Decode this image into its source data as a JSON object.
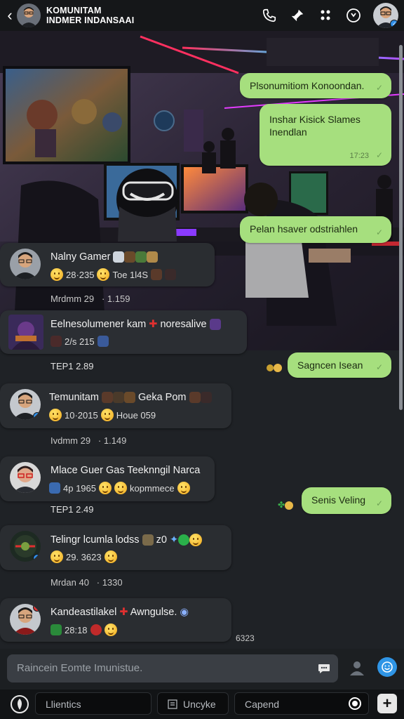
{
  "header": {
    "title_line1": "KOMUNITAM",
    "title_line2": "INDMER INDANSAAI",
    "icons": [
      "back-arrow",
      "phone-icon",
      "pin-icon",
      "grid-icon",
      "info-icon",
      "profile-avatar"
    ]
  },
  "messages_out": [
    {
      "text": "Plsonumitiom Konoondan.",
      "status": "read"
    },
    {
      "text_line1": "Inshar Kisick Slames",
      "text_line2": "Inendlan",
      "time": "17:23",
      "status": "read"
    },
    {
      "text": "Pelan hsaver odstriahlen",
      "status": "read"
    },
    {
      "text": "Sagncen Isean",
      "status": "read"
    },
    {
      "text": "Senis Veling",
      "status": "read"
    }
  ],
  "messages_in": [
    {
      "name": "Nalny Gamer",
      "line2_a": "28·235",
      "line2_b": "Toe 1l4S",
      "meta_a": "Mrdmm 29",
      "meta_b": "· 1.159"
    },
    {
      "name": "Eelnesolumener kam",
      "name_b": "noresalive",
      "line2": "2/s 215",
      "meta_a": "TEP1",
      "meta_b": "2.89"
    },
    {
      "name": "Temunitam",
      "name_b": "Geka Pom",
      "line2_a": "10·2015",
      "line2_b": "Houe 059",
      "meta_a": "Ivdmm 29",
      "meta_b": "· 1.149"
    },
    {
      "name": "Mlace Guer Gas Teeknngil Narca",
      "line2_a": "4p 1965",
      "line2_b": "kopmmece",
      "meta_a": "TEP1",
      "meta_b": "2.49"
    },
    {
      "name": "Telingr lcumla lodss",
      "name_b": "z0",
      "line2": "29. 3623",
      "meta_a": "Mrdan 40",
      "meta_b": "· 1330"
    },
    {
      "name": "Kandeastilakel",
      "name_b": "Awngulse.",
      "line2": "28:18",
      "meta_a": "",
      "meta_b": "6323"
    }
  ],
  "composer": {
    "placeholder": "Raincein Eomte Imunistue."
  },
  "bottom_tabs": [
    "Llientics",
    "Uncyke",
    "Capend"
  ],
  "colors": {
    "out_bubble": "#a6df7e",
    "in_card": "#2a2d31",
    "accent": "#2f95e6",
    "background": "#1f2226"
  }
}
